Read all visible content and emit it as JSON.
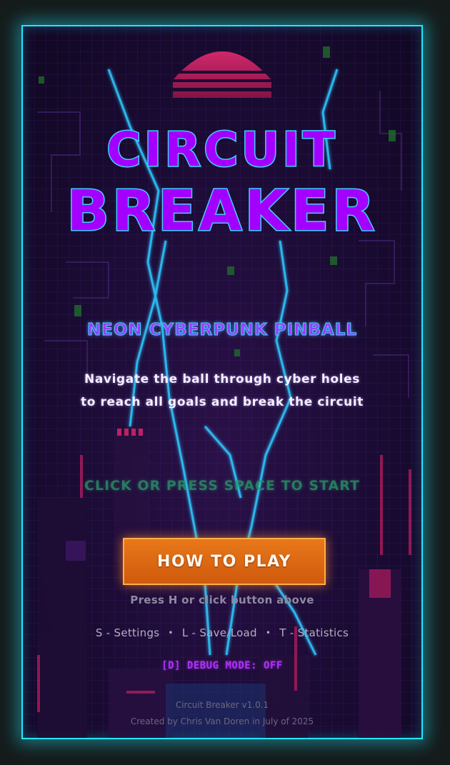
{
  "game": {
    "title_line1": "CIRCUIT",
    "title_line2": "BREAKER",
    "subtitle": "NEON CYBERPUNK PINBALL",
    "tagline_line1": "Navigate the ball through cyber holes",
    "tagline_line2": "to reach all goals and break the circuit",
    "start_prompt": "CLICK OR PRESS SPACE TO START",
    "how_to_play_label": "HOW TO PLAY",
    "help_hint": "Press H or click button above",
    "shortcuts": [
      {
        "label": "S - Settings"
      },
      {
        "label": "L - Save/Load"
      },
      {
        "label": "T - Statistics"
      }
    ],
    "shortcut_separator": "•",
    "debug_status": "[D] DEBUG MODE: OFF",
    "version": "Circuit Breaker v1.0.1",
    "credits": "Created by Chris Van Doren in July of 2025"
  },
  "colors": {
    "frame_border": "#22e6ff",
    "title_fill": "#a400ff",
    "title_outline": "#3fd0ff",
    "button_orange": "#e9781a",
    "debug_purple": "#b130ff",
    "lightning": "#2ec8ff",
    "sun": "#d6205f"
  },
  "icons": {
    "background": "pixel-cityscape-lightning-background"
  }
}
